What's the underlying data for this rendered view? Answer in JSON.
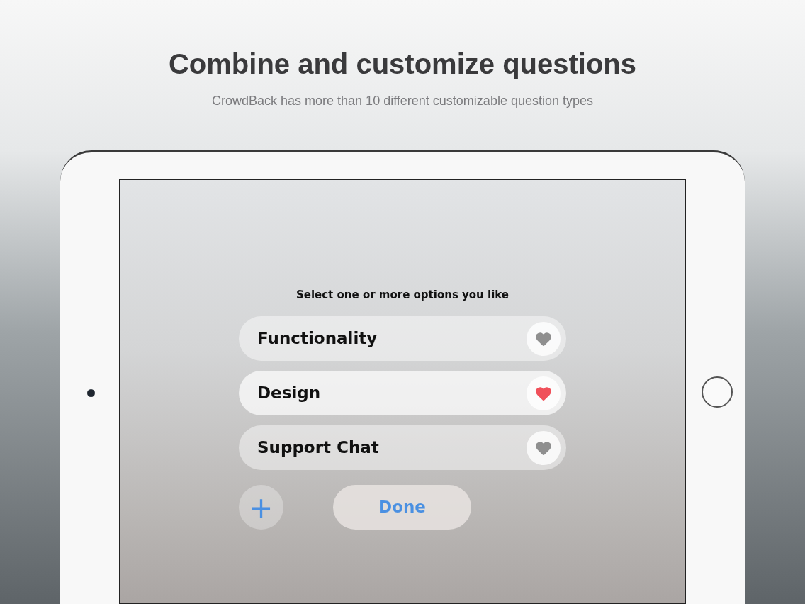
{
  "headline": "Combine and customize questions",
  "subheadline": "CrowdBack has more than 10 different customizable question types",
  "question": {
    "prompt": "Select one or more options you like",
    "options": [
      {
        "label": "Functionality",
        "selected": false
      },
      {
        "label": "Design",
        "selected": true
      },
      {
        "label": "Support Chat",
        "selected": false
      }
    ]
  },
  "add_button": {
    "label": "+"
  },
  "done_button": {
    "label": "Done"
  }
}
